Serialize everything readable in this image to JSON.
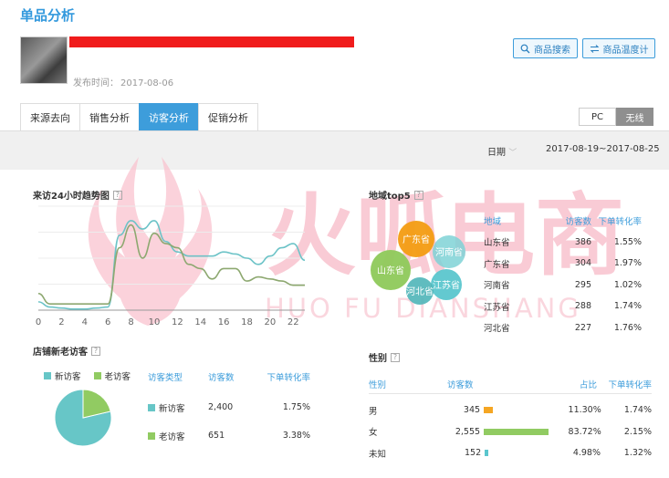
{
  "header": {
    "title": "单品分析",
    "publish_label": "发布时间：",
    "publish_date": "2017-08-06",
    "search_button": "商品搜索",
    "temperature_button": "商品温度计"
  },
  "tabs": [
    {
      "label": "来源去向",
      "active": false
    },
    {
      "label": "销售分析",
      "active": false
    },
    {
      "label": "访客分析",
      "active": true
    },
    {
      "label": "促销分析",
      "active": false
    }
  ],
  "device_toggle": {
    "pc": "PC",
    "wireless": "无线",
    "selected": "无线"
  },
  "date_filter": {
    "label": "日期",
    "range": "2017-08-19~2017-08-25"
  },
  "watermark": {
    "cn": "火呱电商",
    "en": "HUO FU DIANSHANG"
  },
  "trend": {
    "title": "来访24小时趋势图",
    "help": "?"
  },
  "region": {
    "title": "地域top5",
    "help": "?",
    "headers": [
      "地域",
      "访客数",
      "下单转化率"
    ],
    "rows": [
      {
        "name": "山东省",
        "visitors": "386",
        "rate": "1.55%"
      },
      {
        "name": "广东省",
        "visitors": "304",
        "rate": "1.97%"
      },
      {
        "name": "河南省",
        "visitors": "295",
        "rate": "1.02%"
      },
      {
        "name": "江苏省",
        "visitors": "288",
        "rate": "1.74%"
      },
      {
        "name": "河北省",
        "visitors": "227",
        "rate": "1.76%"
      }
    ],
    "bubbles": [
      {
        "label": "广东省",
        "color": "#f39c12"
      },
      {
        "label": "河南省",
        "color": "#7fd2d6"
      },
      {
        "label": "山东省",
        "color": "#8ec95a"
      },
      {
        "label": "江苏省",
        "color": "#5bc6cd"
      },
      {
        "label": "河北省",
        "color": "#4fb5b8"
      }
    ]
  },
  "visitors": {
    "title": "店铺新老访客",
    "help": "?",
    "legend": [
      {
        "label": "新访客",
        "color": "#67c6c7"
      },
      {
        "label": "老访客",
        "color": "#91cb62"
      }
    ],
    "headers": [
      "访客类型",
      "访客数",
      "下单转化率"
    ],
    "rows": [
      {
        "type": "新访客",
        "count": "2,400",
        "rate": "1.75%",
        "color": "#67c6c7"
      },
      {
        "type": "老访客",
        "count": "651",
        "rate": "3.38%",
        "color": "#91cb62"
      }
    ]
  },
  "gender": {
    "title": "性别",
    "help": "?",
    "headers": [
      "性别",
      "访客数",
      "占比",
      "下单转化率"
    ],
    "rows": [
      {
        "sex": "男",
        "visitors": "345",
        "share": "11.30%",
        "rate": "1.74%",
        "color": "#f5a623"
      },
      {
        "sex": "女",
        "visitors": "2,555",
        "share": "83.72%",
        "rate": "2.15%",
        "color": "#91cb62"
      },
      {
        "sex": "未知",
        "visitors": "152",
        "share": "4.98%",
        "rate": "1.32%",
        "color": "#5bc6cd"
      }
    ]
  },
  "chart_data": [
    {
      "type": "line",
      "title": "来访24小时趋势图",
      "x": [
        0,
        1,
        2,
        3,
        4,
        5,
        6,
        7,
        8,
        9,
        10,
        11,
        12,
        13,
        14,
        15,
        16,
        17,
        18,
        19,
        20,
        21,
        22,
        23
      ],
      "xticks": [
        "0",
        "2",
        "4",
        "6",
        "8",
        "10",
        "12",
        "14",
        "16",
        "18",
        "20",
        "22"
      ],
      "series": [
        {
          "color": "#6cc3c7",
          "values": [
            8,
            3,
            2,
            1,
            1,
            2,
            3,
            72,
            86,
            78,
            86,
            66,
            56,
            52,
            52,
            52,
            56,
            54,
            50,
            44,
            52,
            60,
            64,
            48
          ]
        },
        {
          "color": "#8da870",
          "values": [
            16,
            6,
            6,
            6,
            6,
            6,
            6,
            60,
            82,
            50,
            74,
            64,
            60,
            44,
            40,
            30,
            40,
            40,
            28,
            32,
            30,
            28,
            24,
            24
          ]
        }
      ]
    },
    {
      "type": "pie",
      "title": "店铺新老访客",
      "labels": [
        "新访客",
        "老访客"
      ],
      "values": [
        2400,
        651
      ],
      "colors": [
        "#67c6c7",
        "#91cb62"
      ]
    }
  ]
}
